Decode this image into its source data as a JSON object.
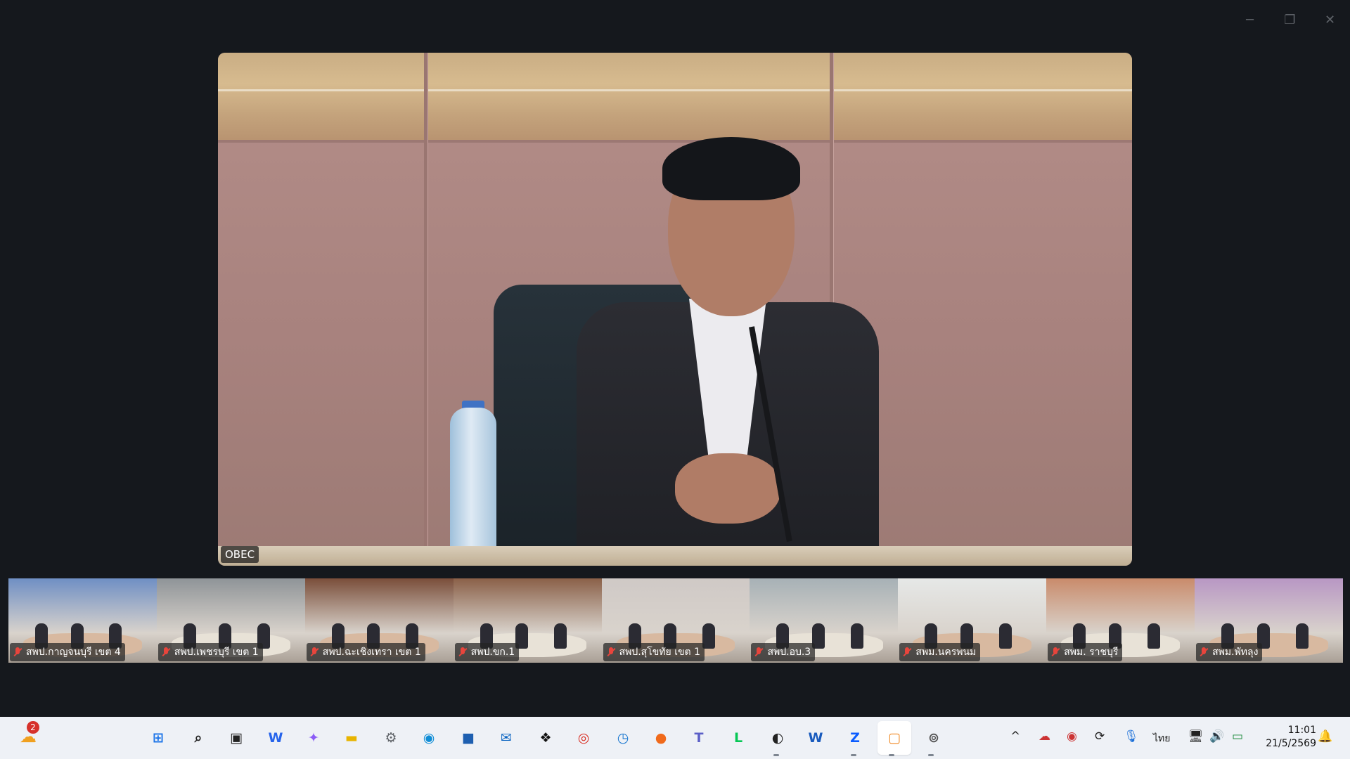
{
  "window_controls": {
    "minimize_icon": "─",
    "restore_icon": "❐",
    "close_icon": "✕"
  },
  "main_video": {
    "participant_name": "OBEC"
  },
  "gallery": [
    {
      "name": "สพป.กาญจนบุรี เขต 4",
      "bg": "#6f8fc4"
    },
    {
      "name": "สพป.เพชรบุรี เขต 1",
      "bg": "#8f9498"
    },
    {
      "name": "สพป.ฉะเชิงเทรา เขต 1",
      "bg": "#7a4e3a"
    },
    {
      "name": "สพป.ขก.1",
      "bg": "#8a6048"
    },
    {
      "name": "สพป.สุโขทัย เขต 1",
      "bg": "#cfc9c6"
    },
    {
      "name": "สพป.อบ.3",
      "bg": "#a7b1b6"
    },
    {
      "name": "สพม.นครพนม",
      "bg": "#e6e8e7"
    },
    {
      "name": "สพม. ราชบุรี",
      "bg": "#c98b6b"
    },
    {
      "name": "สพม.พัทลุง",
      "bg": "#b897c4"
    }
  ],
  "taskbar": {
    "weather_badge": "2",
    "apps": [
      {
        "name": "start",
        "glyph": "⊞",
        "color": "#1a73e8"
      },
      {
        "name": "search",
        "glyph": "⌕",
        "color": "#222"
      },
      {
        "name": "task-view",
        "glyph": "▣",
        "color": "#222"
      },
      {
        "name": "widgets",
        "glyph": "W",
        "color": "#2563eb"
      },
      {
        "name": "copilot",
        "glyph": "✦",
        "color": "#8b5cf6"
      },
      {
        "name": "file-explorer",
        "glyph": "▬",
        "color": "#e8b400"
      },
      {
        "name": "settings",
        "glyph": "⚙",
        "color": "#5f6368"
      },
      {
        "name": "edge",
        "glyph": "◉",
        "color": "#0f8dd6"
      },
      {
        "name": "store",
        "glyph": "■",
        "color": "#1e5fb0"
      },
      {
        "name": "outlook",
        "glyph": "✉",
        "color": "#0a64c2"
      },
      {
        "name": "dropbox",
        "glyph": "❖",
        "color": "#111"
      },
      {
        "name": "chrome",
        "glyph": "◎",
        "color": "#d93025"
      },
      {
        "name": "clock-app",
        "glyph": "◷",
        "color": "#1b78d0"
      },
      {
        "name": "firefox",
        "glyph": "●",
        "color": "#f06a1b"
      },
      {
        "name": "teams",
        "glyph": "T",
        "color": "#5b5fc7"
      },
      {
        "name": "line",
        "glyph": "L",
        "color": "#06c755"
      },
      {
        "name": "obs",
        "glyph": "◐",
        "color": "#222"
      },
      {
        "name": "word",
        "glyph": "W",
        "color": "#185abd"
      },
      {
        "name": "zoom",
        "glyph": "Z",
        "color": "#0b5cff"
      },
      {
        "name": "presenter",
        "glyph": "▢",
        "color": "#f08a24"
      },
      {
        "name": "broadcast",
        "glyph": "⊚",
        "color": "#555"
      }
    ],
    "tray": {
      "chevron": "^",
      "lang": "ไทย"
    },
    "clock": {
      "time": "11:01",
      "date": "21/5/2569"
    }
  }
}
